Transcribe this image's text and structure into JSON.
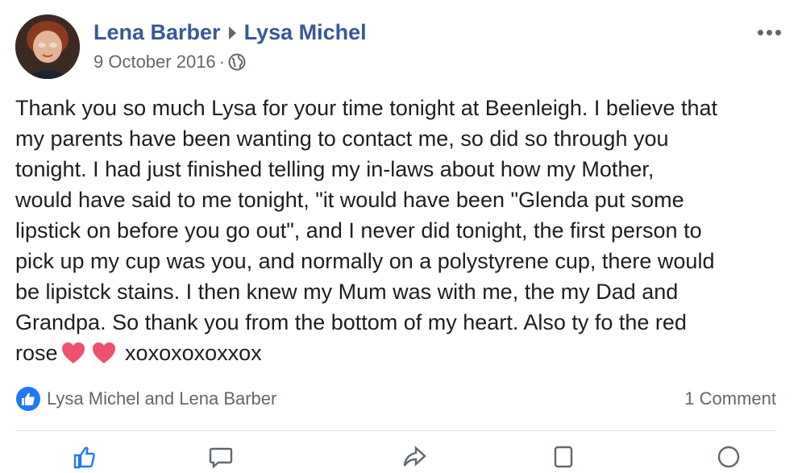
{
  "post": {
    "author": "Lena Barber",
    "recipient": "Lysa Michel",
    "date": "9 October 2016",
    "separator_dot": "·",
    "privacy_icon": "globe-icon",
    "more_icon": "more-options-icon",
    "message_part1": "Thank you so much Lysa for your time tonight at Beenleigh. I believe that\nmy parents have been wanting to contact me, so did so through you\ntonight. I had just finished telling my in-laws about how my Mother,\nwould have said to me tonight, \"it would have been \"Glenda put some\nlipstick on before you go out\", and I never did tonight, the first person to\npick up my cup was you, and normally on a polystyrene cup, there would\nbe lipistck stains. I then knew my Mum was with me, the my Dad and\nGrandpa. So thank you from the bottom of my heart. Also ty fo the red\nrose",
    "message_part2": "xoxoxoxoxxox",
    "heart_icon": "heart-icon",
    "heart_color": "#f0506e"
  },
  "reactions": {
    "icon": "like-icon",
    "names": "Lysa Michel and Lena Barber",
    "comment_count": "1 Comment",
    "accent_color": "#2078f4"
  },
  "colors": {
    "name_link": "#385898",
    "secondary_text": "#606770",
    "body_text": "#1c1e21"
  }
}
